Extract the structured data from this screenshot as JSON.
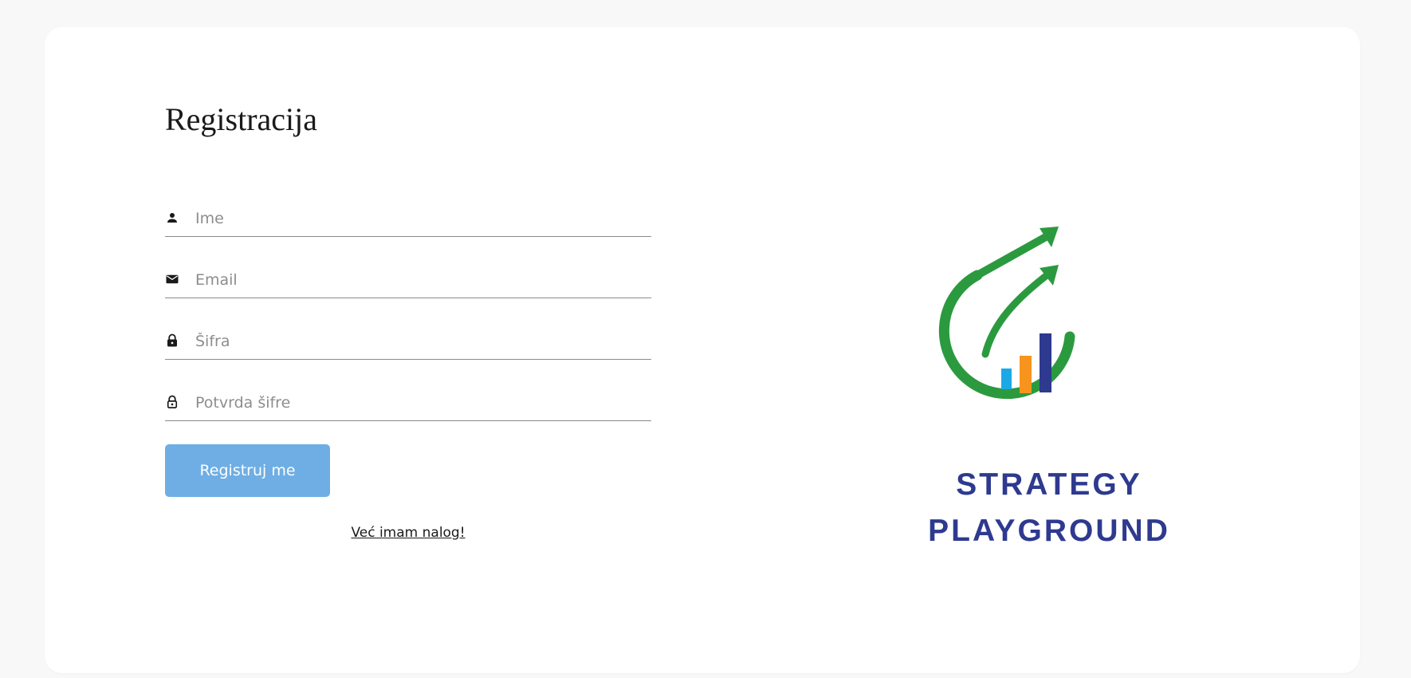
{
  "form": {
    "title": "Registracija",
    "fields": [
      {
        "icon": "person-icon",
        "placeholder": "Ime",
        "value": ""
      },
      {
        "icon": "mail-icon",
        "placeholder": "Email",
        "value": ""
      },
      {
        "icon": "lock-icon",
        "placeholder": "Šifra",
        "value": ""
      },
      {
        "icon": "lock-outline-icon",
        "placeholder": "Potvrda šifre",
        "value": ""
      }
    ],
    "submit_label": "Registruj me",
    "login_link": "Već imam nalog!"
  },
  "logo": {
    "line1": "STRATEGY",
    "line2": "PLAYGROUND"
  },
  "colors": {
    "button": "#6eaee4",
    "logo_green": "#2b9a3f",
    "logo_blue": "#2e3a8f",
    "logo_orange": "#f7941d",
    "logo_light_blue": "#1ba9e6"
  }
}
